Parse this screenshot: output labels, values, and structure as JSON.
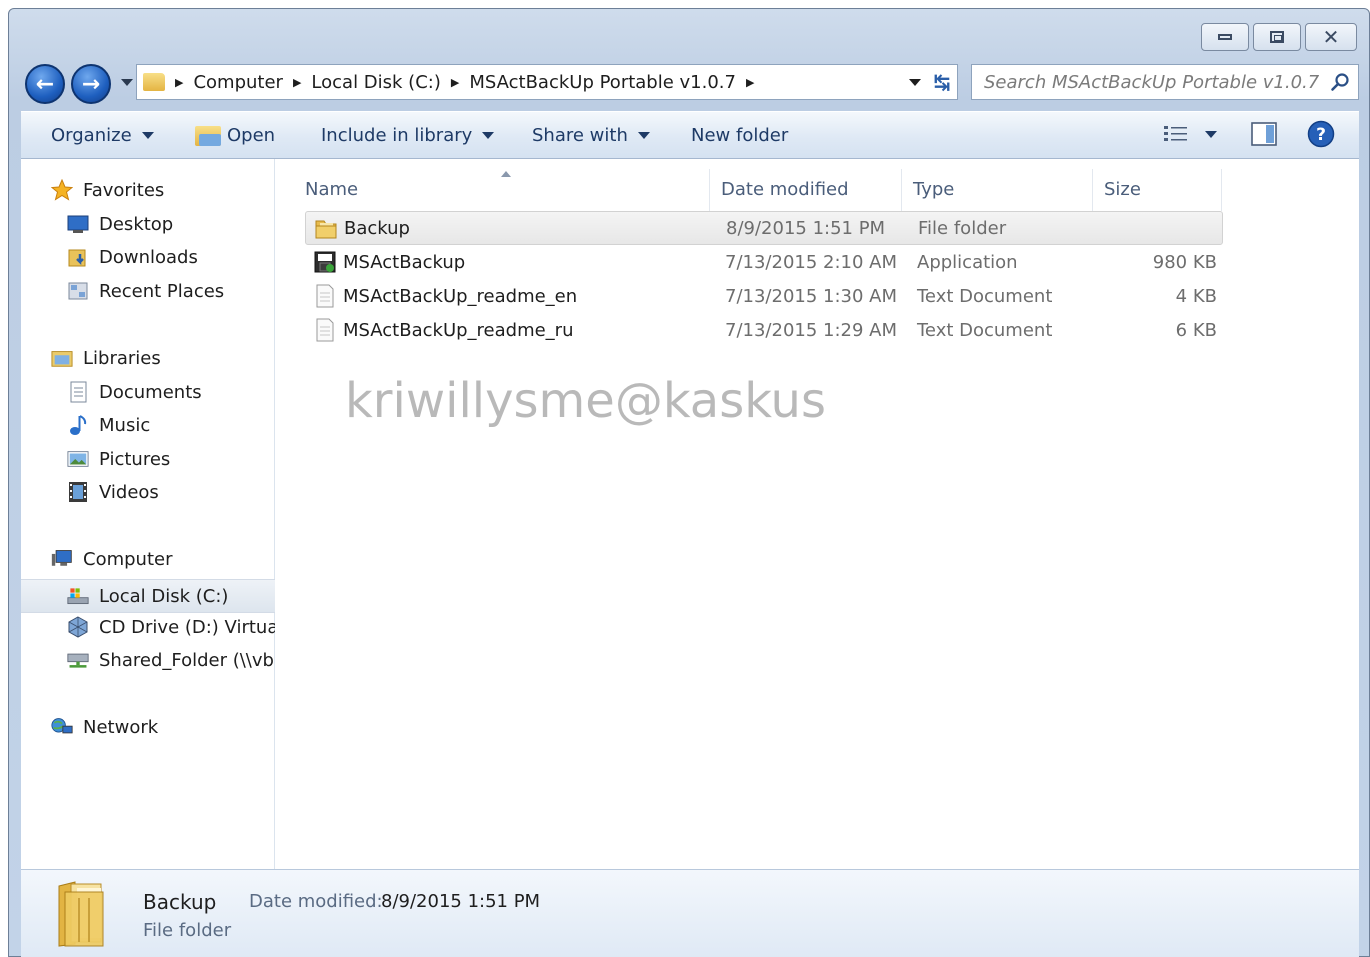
{
  "window": {
    "caption": {
      "minimize": "minimize",
      "maximize": "maximize",
      "close": "close"
    }
  },
  "address": {
    "crumbs": [
      "Computer",
      "Local Disk (C:)",
      "MSActBackUp Portable v1.0.7"
    ]
  },
  "search": {
    "placeholder": "Search MSActBackUp Portable v1.0.7"
  },
  "toolbar": {
    "organize": "Organize",
    "open": "Open",
    "include_in_library": "Include in library",
    "share_with": "Share with",
    "new_folder": "New folder"
  },
  "nav": {
    "favorites": "Favorites",
    "desktop": "Desktop",
    "downloads": "Downloads",
    "recent_places": "Recent Places",
    "libraries": "Libraries",
    "documents": "Documents",
    "music": "Music",
    "pictures": "Pictures",
    "videos": "Videos",
    "computer": "Computer",
    "local_disk": "Local Disk (C:)",
    "cd_drive": "CD Drive (D:) Virtual",
    "shared_folder": "Shared_Folder (\\\\vb",
    "network": "Network"
  },
  "columns": {
    "name": "Name",
    "date": "Date modified",
    "type": "Type",
    "size": "Size"
  },
  "files": [
    {
      "name": "Backup",
      "date": "8/9/2015 1:51 PM",
      "type": "File folder",
      "size": "",
      "icon": "folder-icon"
    },
    {
      "name": "MSActBackup",
      "date": "7/13/2015 2:10 AM",
      "type": "Application",
      "size": "980 KB",
      "icon": "application-icon"
    },
    {
      "name": "MSActBackUp_readme_en",
      "date": "7/13/2015 1:30 AM",
      "type": "Text Document",
      "size": "4 KB",
      "icon": "text-document-icon"
    },
    {
      "name": "MSActBackUp_readme_ru",
      "date": "7/13/2015 1:29 AM",
      "type": "Text Document",
      "size": "6 KB",
      "icon": "text-document-icon"
    }
  ],
  "watermark": "kriwillysme@kaskus",
  "details": {
    "name": "Backup",
    "type": "File folder",
    "date_label": "Date modified:",
    "date_value": "8/9/2015 1:51 PM"
  }
}
